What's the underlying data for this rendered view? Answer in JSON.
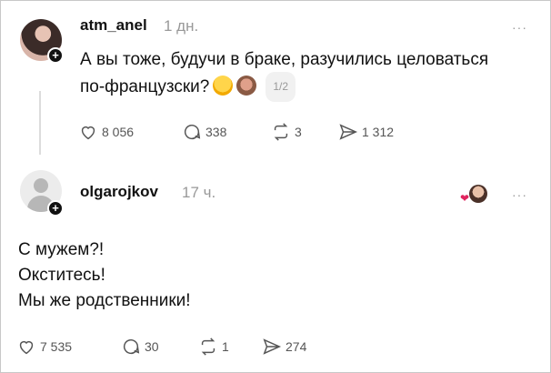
{
  "posts": [
    {
      "username": "atm_anel",
      "time": "1 дн.",
      "text": "А вы тоже, будучи в браке, разучились целоваться",
      "text2": "по-французски?",
      "pager": "1/2",
      "likes": "8 056",
      "comments": "338",
      "reposts": "3",
      "shares": "1 312",
      "icons": [
        "heart-icon",
        "comment-icon",
        "repost-icon",
        "send-icon"
      ]
    },
    {
      "username": "olgarojkov",
      "time": "17 ч.",
      "lines": [
        "С мужем?!",
        "Окститесь!",
        "Мы же родственники!"
      ],
      "likes": "7 535",
      "comments": "30",
      "reposts": "1",
      "shares": "274"
    }
  ],
  "more_label": "···",
  "plus_label": "+"
}
